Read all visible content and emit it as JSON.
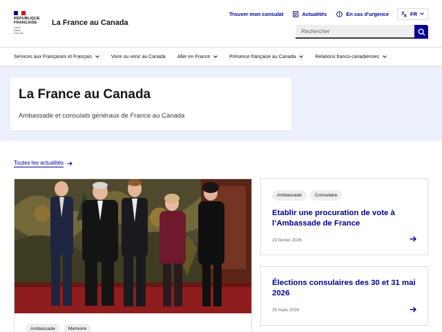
{
  "header": {
    "logo_line1": "RÉPUBLIQUE",
    "logo_line2": "FRANÇAISE",
    "logo_motto1": "Liberté",
    "logo_motto2": "Égalité",
    "logo_motto3": "Fraternité",
    "site_title": "La France au Canada",
    "tools": {
      "consulat": "Trouver mon consulat",
      "actualites": "Actualités",
      "urgence": "En cas d'urgence",
      "lang": "FR"
    },
    "search": {
      "placeholder": "Rechercher",
      "button_icon": "search-icon"
    }
  },
  "nav": {
    "items": [
      {
        "label": "Services aux Françaises et Français",
        "has_dropdown": true
      },
      {
        "label": "Vivre ou venir au Canada",
        "has_dropdown": false
      },
      {
        "label": "Aller en France",
        "has_dropdown": true
      },
      {
        "label": "Présence française au Canada",
        "has_dropdown": true
      },
      {
        "label": "Relations franco-canadiennes",
        "has_dropdown": true
      }
    ]
  },
  "hero": {
    "title": "La France au Canada",
    "subtitle": "Ambassade et consulats généraux de France au Canada"
  },
  "news": {
    "all_link": "Toutes les actualités",
    "main": {
      "tags": [
        "Ambassade",
        "Mémoire"
      ]
    },
    "cards": [
      {
        "tags": [
          "Ambassade",
          "Consulaire"
        ],
        "title": "Etablir une procuration de vote à l’Ambassade de France",
        "date": "19 février 2026"
      },
      {
        "tags": [],
        "title": "Élections consulaires des 30 et 31 mai 2026",
        "date": "25 mars 2026"
      }
    ]
  },
  "colors": {
    "primary": "#000091",
    "hero_bg": "#ecf0fb",
    "flag_red": "#e1000f",
    "tag_bg": "#eeeeee"
  }
}
